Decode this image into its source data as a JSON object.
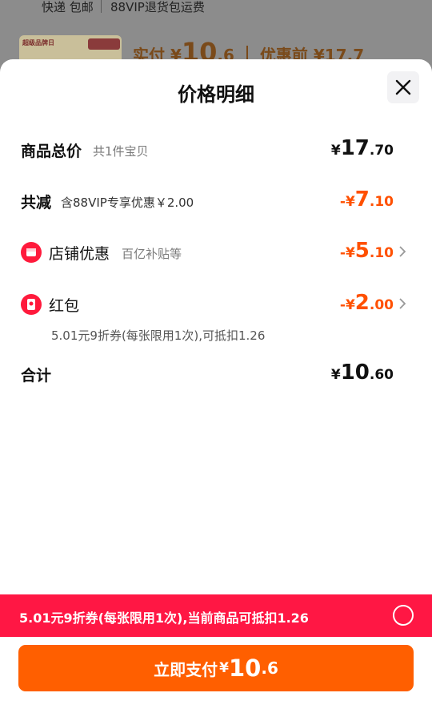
{
  "background": {
    "shipping_text": "快递 包邮",
    "return_text": "88VIP退货包运费",
    "thumb_tag": "超级品牌日",
    "price_label": "实付",
    "price_currency": "¥",
    "price_int": "10",
    "price_dec": ".6",
    "orig_label": "优惠前",
    "orig_price": "¥17.7"
  },
  "sheet": {
    "title": "价格明细"
  },
  "rows": {
    "total": {
      "label": "商品总价",
      "sub": "共1件宝贝",
      "currency": "¥",
      "int": "17",
      "dec": ".70"
    },
    "reduce": {
      "label": "共减",
      "sub": "含88VIP专享优惠￥2.00",
      "currency": "-¥",
      "int": "7",
      "dec": ".10"
    },
    "shop": {
      "label": "店铺优惠",
      "sub": "百亿补贴等",
      "currency": "-¥",
      "int": "5",
      "dec": ".10"
    },
    "redpacket": {
      "label": "红包",
      "currency": "-¥",
      "int": "2",
      "dec": ".00",
      "note": "5.01元9折券(每张限用1次),可抵扣1.26"
    },
    "sum": {
      "label": "合计",
      "currency": "¥",
      "int": "10",
      "dec": ".60"
    }
  },
  "coupon": {
    "text": "5.01元9折券(每张限用1次),当前商品可抵扣1.26"
  },
  "pay": {
    "label": "立即支付",
    "currency": "¥",
    "int": "10",
    "dec": ".6"
  },
  "colors": {
    "accent": "#ff5000",
    "coupon_bg": "#ff1744",
    "pay_bg": "#ff5f00"
  }
}
